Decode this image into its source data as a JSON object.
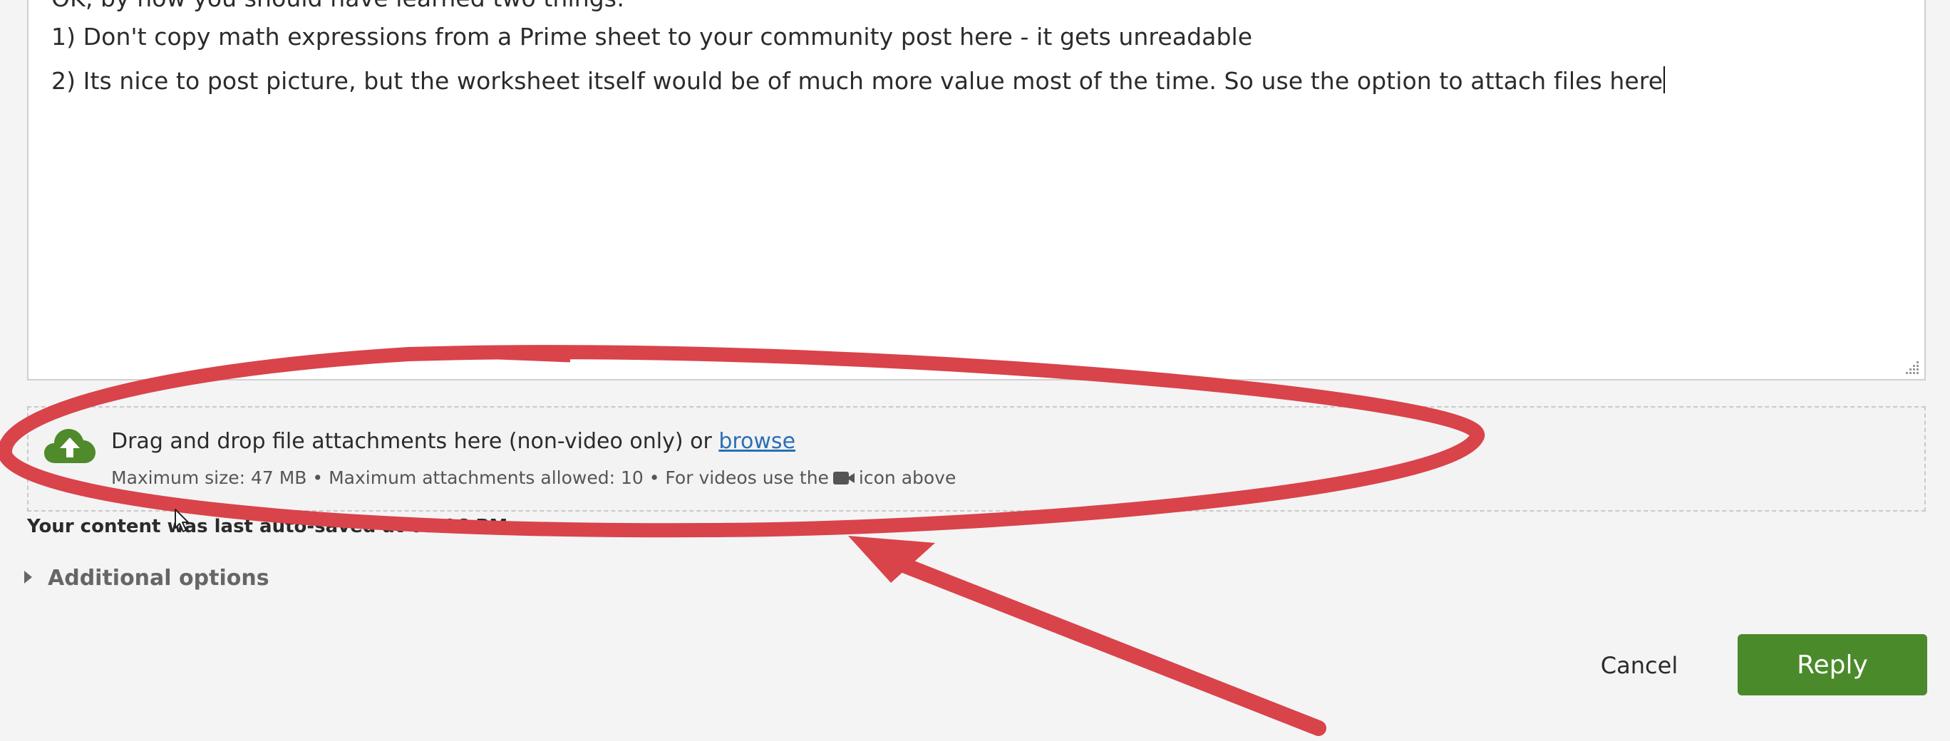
{
  "editor": {
    "line_top": "OK, by now you should have learned two things:",
    "line_1": "1) Don't copy math expressions from a Prime sheet to your community post here - it gets unreadable",
    "line_2": "2) Its nice to post picture, but the worksheet itself would be of much more value most of the time. So use the option to attach files here"
  },
  "attachments": {
    "drop_text": "Drag and drop file attachments here (non-video only) or ",
    "browse_label": "browse",
    "limits_text": "Maximum size: 47 MB • Maximum attachments allowed: 10 • For videos use the",
    "limits_suffix": "icon above",
    "icons": [
      "cloud-upload-icon",
      "video-camera-icon"
    ]
  },
  "autosave_text": "Your content was last auto-saved at 03:06 PM",
  "additional_options_label": "Additional options",
  "buttons": {
    "cancel": "Cancel",
    "reply": "Reply"
  },
  "colors": {
    "reply_green": "#4a8a2a",
    "upload_icon_green": "#4f8a2b",
    "link_blue": "#2a6fb5",
    "annotation_red": "#d9434a"
  }
}
